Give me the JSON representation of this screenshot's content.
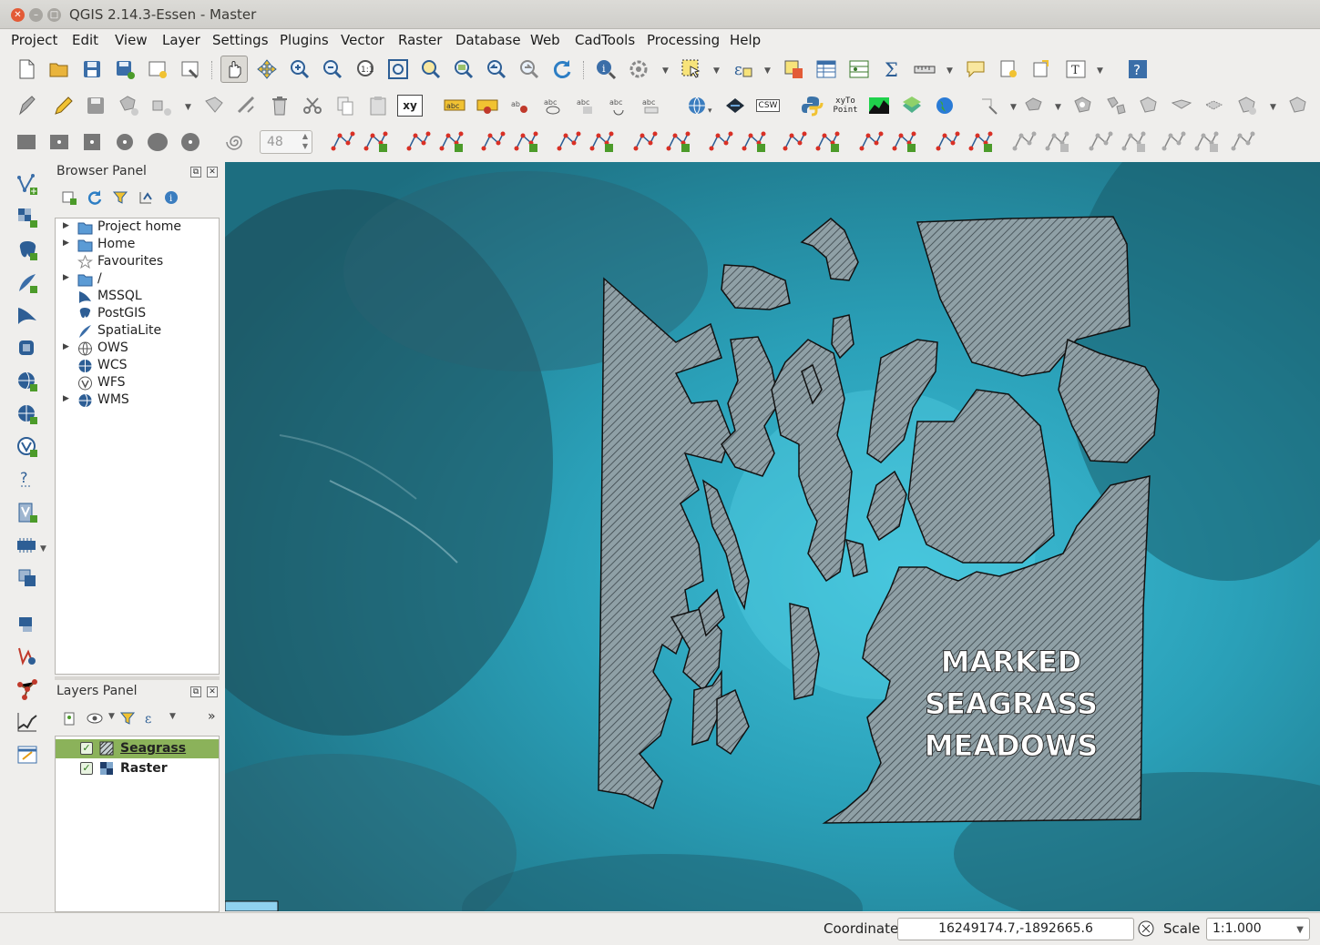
{
  "window": {
    "title": "QGIS 2.14.3-Essen - Master"
  },
  "menu": [
    "Project",
    "Edit",
    "View",
    "Layer",
    "Settings",
    "Plugins",
    "Vector",
    "Raster",
    "Database",
    "Web",
    "CadTools",
    "Processing",
    "Help"
  ],
  "toolbar": {
    "spin_value": "48",
    "xy_label": "xy",
    "csw_label": "CSW",
    "xyto_label": "xyTo",
    "point_label": "Point"
  },
  "browser_panel": {
    "title": "Browser Panel",
    "items": [
      {
        "label": "Project home",
        "icon": "folder-icon",
        "expandable": true
      },
      {
        "label": "Home",
        "icon": "folder-icon",
        "expandable": true
      },
      {
        "label": "Favourites",
        "icon": "star-icon",
        "expandable": false
      },
      {
        "label": "/",
        "icon": "folder-icon",
        "expandable": true
      },
      {
        "label": "MSSQL",
        "icon": "mssql-icon",
        "expandable": false
      },
      {
        "label": "PostGIS",
        "icon": "postgis-icon",
        "expandable": false
      },
      {
        "label": "SpatiaLite",
        "icon": "spatialite-icon",
        "expandable": false
      },
      {
        "label": "OWS",
        "icon": "ows-icon",
        "expandable": true
      },
      {
        "label": "WCS",
        "icon": "wcs-icon",
        "expandable": false
      },
      {
        "label": "WFS",
        "icon": "wfs-icon",
        "expandable": false
      },
      {
        "label": "WMS",
        "icon": "wms-icon",
        "expandable": true
      }
    ]
  },
  "layers_panel": {
    "title": "Layers Panel",
    "layers": [
      {
        "name": "Seagrass",
        "checked": true,
        "selected": true,
        "icon": "hatched-polygon-icon"
      },
      {
        "name": "Raster",
        "checked": true,
        "selected": false,
        "icon": "raster-icon"
      }
    ]
  },
  "map": {
    "annotation_lines": [
      "MARKED",
      "SEAGRASS",
      "MEADOWS"
    ]
  },
  "statusbar": {
    "coordinate_label": "Coordinate",
    "coordinate_value": "16249174.7,-1892665.6",
    "scale_label": "Scale",
    "scale_value": "1:1.000"
  },
  "colors": {
    "selected_layer_bg": "#8bb25a",
    "water_light": "#3fb5cc",
    "water_dark": "#1f6f7e",
    "polygon_fill": "#8a9ba0"
  }
}
